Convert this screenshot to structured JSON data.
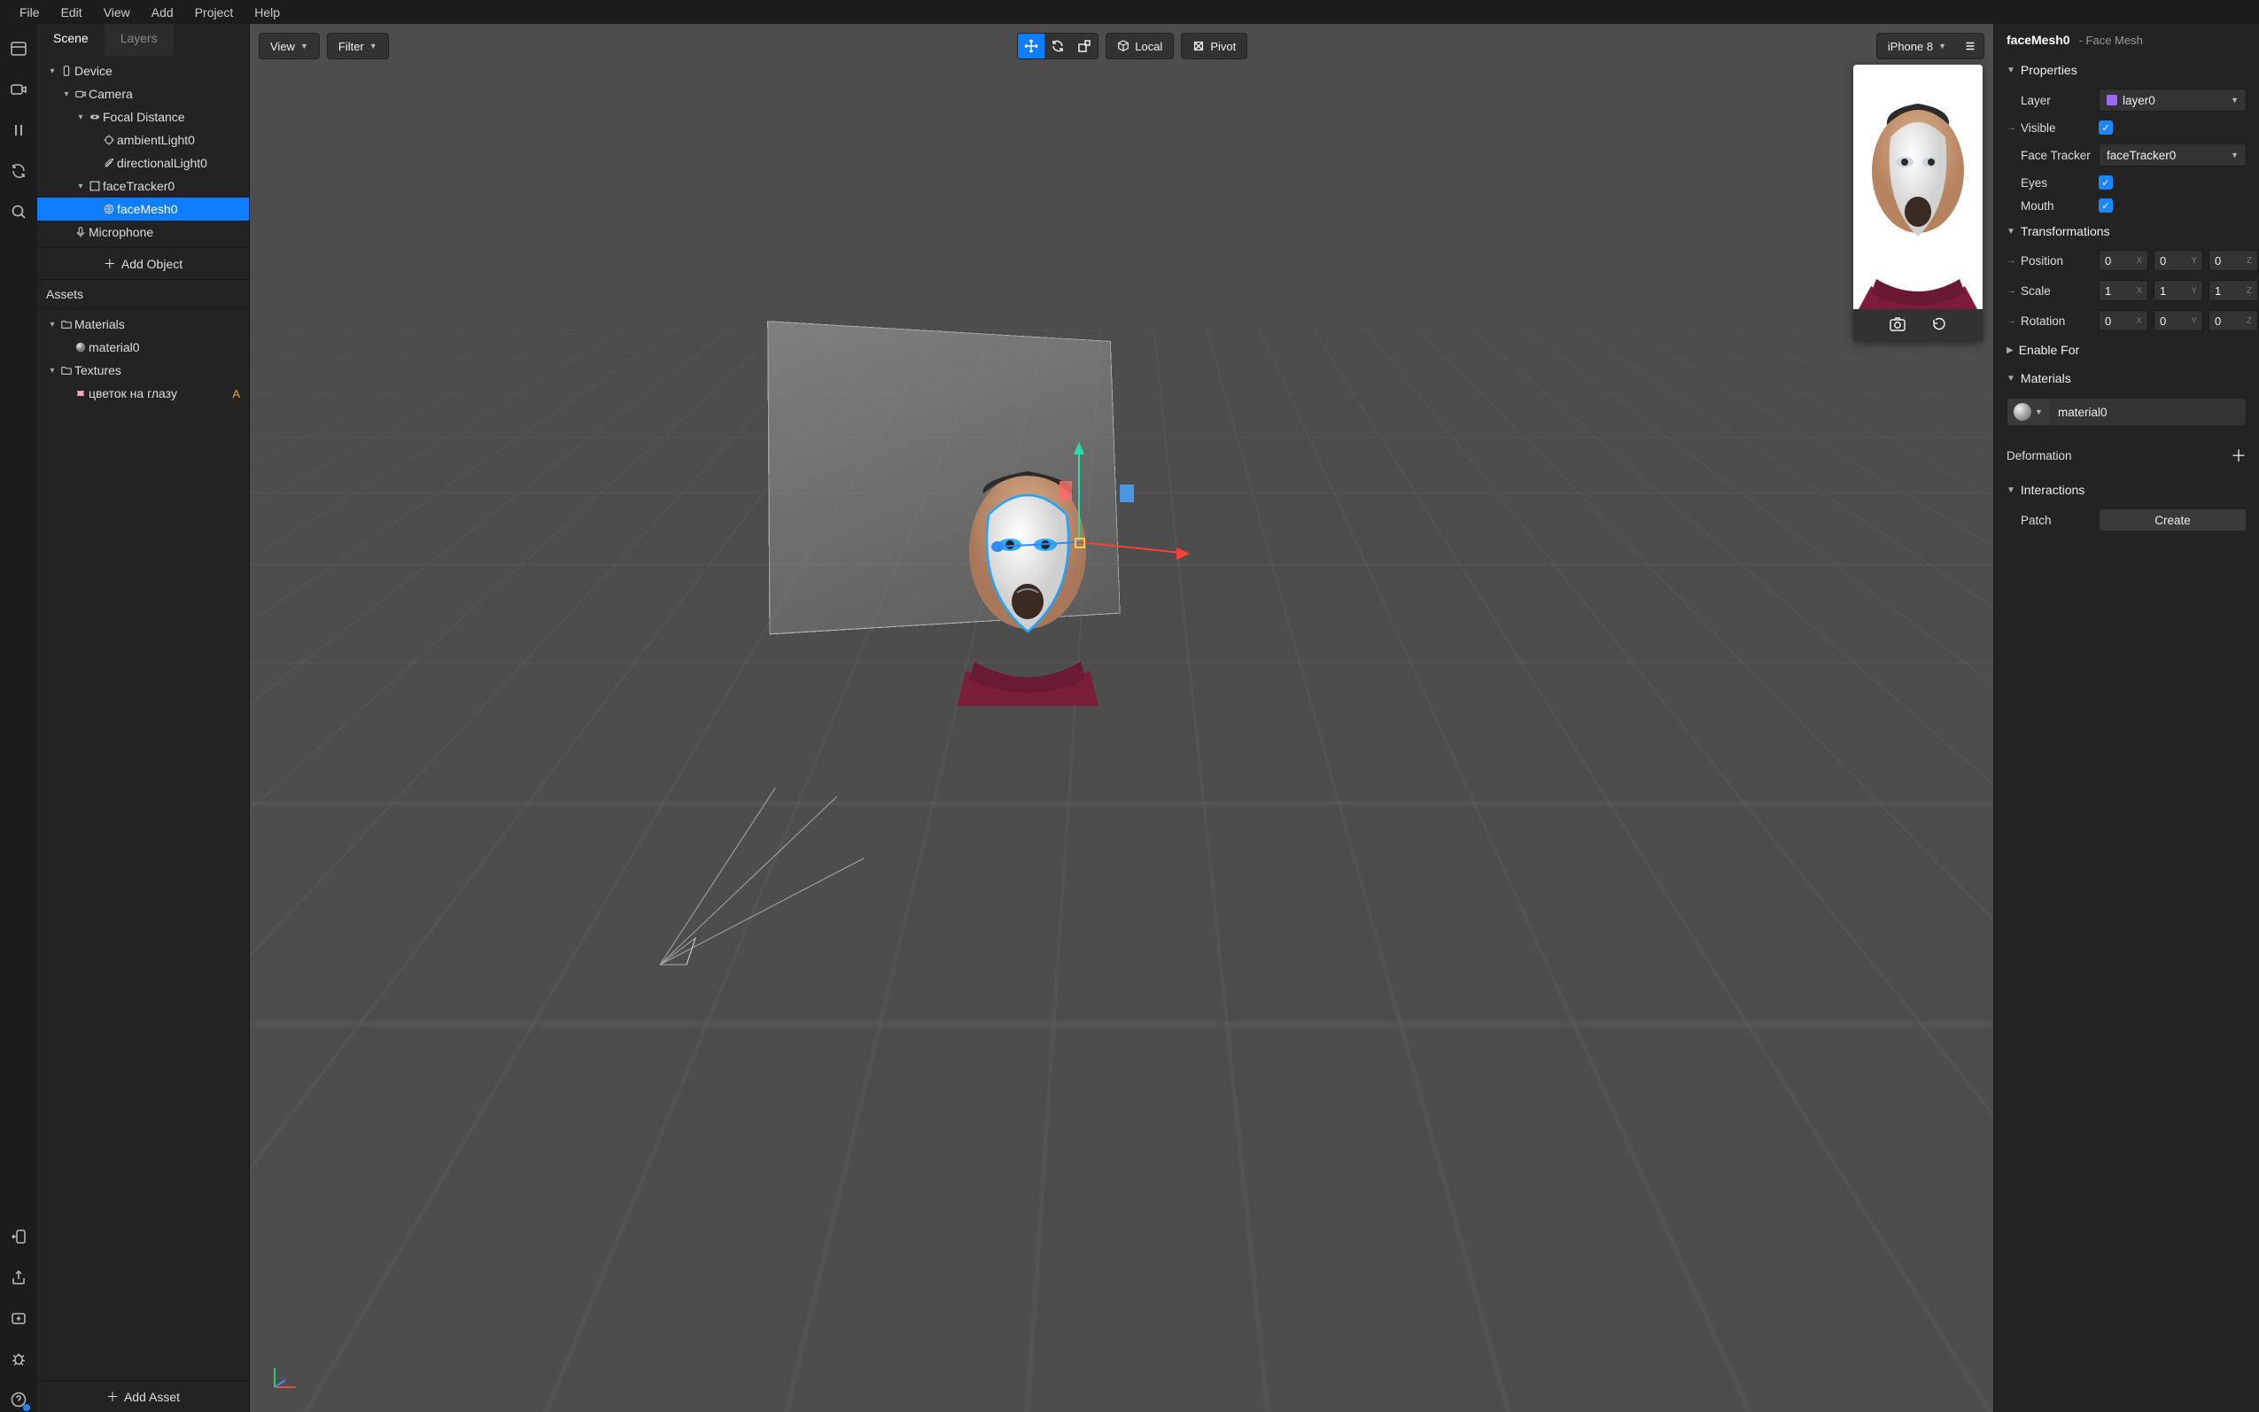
{
  "menubar": [
    "File",
    "Edit",
    "View",
    "Add",
    "Project",
    "Help"
  ],
  "scene": {
    "tab_scene": "Scene",
    "tab_layers": "Layers",
    "items": [
      {
        "depth": 0,
        "twisty": "▾",
        "icon": "device",
        "label": "Device"
      },
      {
        "depth": 1,
        "twisty": "▾",
        "icon": "camera",
        "label": "Camera"
      },
      {
        "depth": 2,
        "twisty": "▾",
        "icon": "focal",
        "label": "Focal Distance"
      },
      {
        "depth": 3,
        "twisty": "",
        "icon": "light",
        "label": "ambientLight0"
      },
      {
        "depth": 3,
        "twisty": "",
        "icon": "dirlight",
        "label": "directionalLight0"
      },
      {
        "depth": 2,
        "twisty": "▾",
        "icon": "tracker",
        "label": "faceTracker0"
      },
      {
        "depth": 3,
        "twisty": "",
        "icon": "facemesh",
        "label": "faceMesh0",
        "selected": true
      },
      {
        "depth": 1,
        "twisty": "",
        "icon": "mic",
        "label": "Microphone"
      }
    ],
    "add_object": "Add Object"
  },
  "assets": {
    "title": "Assets",
    "items": [
      {
        "depth": 0,
        "twisty": "▾",
        "icon": "folder",
        "label": "Materials"
      },
      {
        "depth": 1,
        "twisty": "",
        "icon": "matball",
        "label": "material0"
      },
      {
        "depth": 0,
        "twisty": "▾",
        "icon": "folder",
        "label": "Textures"
      },
      {
        "depth": 1,
        "twisty": "",
        "icon": "tex",
        "label": "цветок на глазу",
        "badge": "A"
      }
    ],
    "add_asset": "Add Asset"
  },
  "viewport": {
    "view_label": "View",
    "filter_label": "Filter",
    "local_label": "Local",
    "pivot_label": "Pivot",
    "device_label": "iPhone 8"
  },
  "inspector": {
    "name": "faceMesh0",
    "type": "- Face Mesh",
    "sections": {
      "properties": "Properties",
      "transformations": "Transformations",
      "enablefor": "Enable For",
      "materials": "Materials",
      "deformation": "Deformation",
      "interactions": "Interactions"
    },
    "layer_label": "Layer",
    "layer_value": "layer0",
    "layer_color": "#9a6bff",
    "visible_label": "Visible",
    "facetracker_label": "Face Tracker",
    "facetracker_value": "faceTracker0",
    "eyes_label": "Eyes",
    "mouth_label": "Mouth",
    "position_label": "Position",
    "scale_label": "Scale",
    "rotation_label": "Rotation",
    "position": {
      "x": "0",
      "y": "0",
      "z": "0"
    },
    "scale": {
      "x": "1",
      "y": "1",
      "z": "1"
    },
    "rotation": {
      "x": "0",
      "y": "0",
      "z": "0"
    },
    "material_name": "material0",
    "patch_label": "Patch",
    "create_label": "Create"
  }
}
